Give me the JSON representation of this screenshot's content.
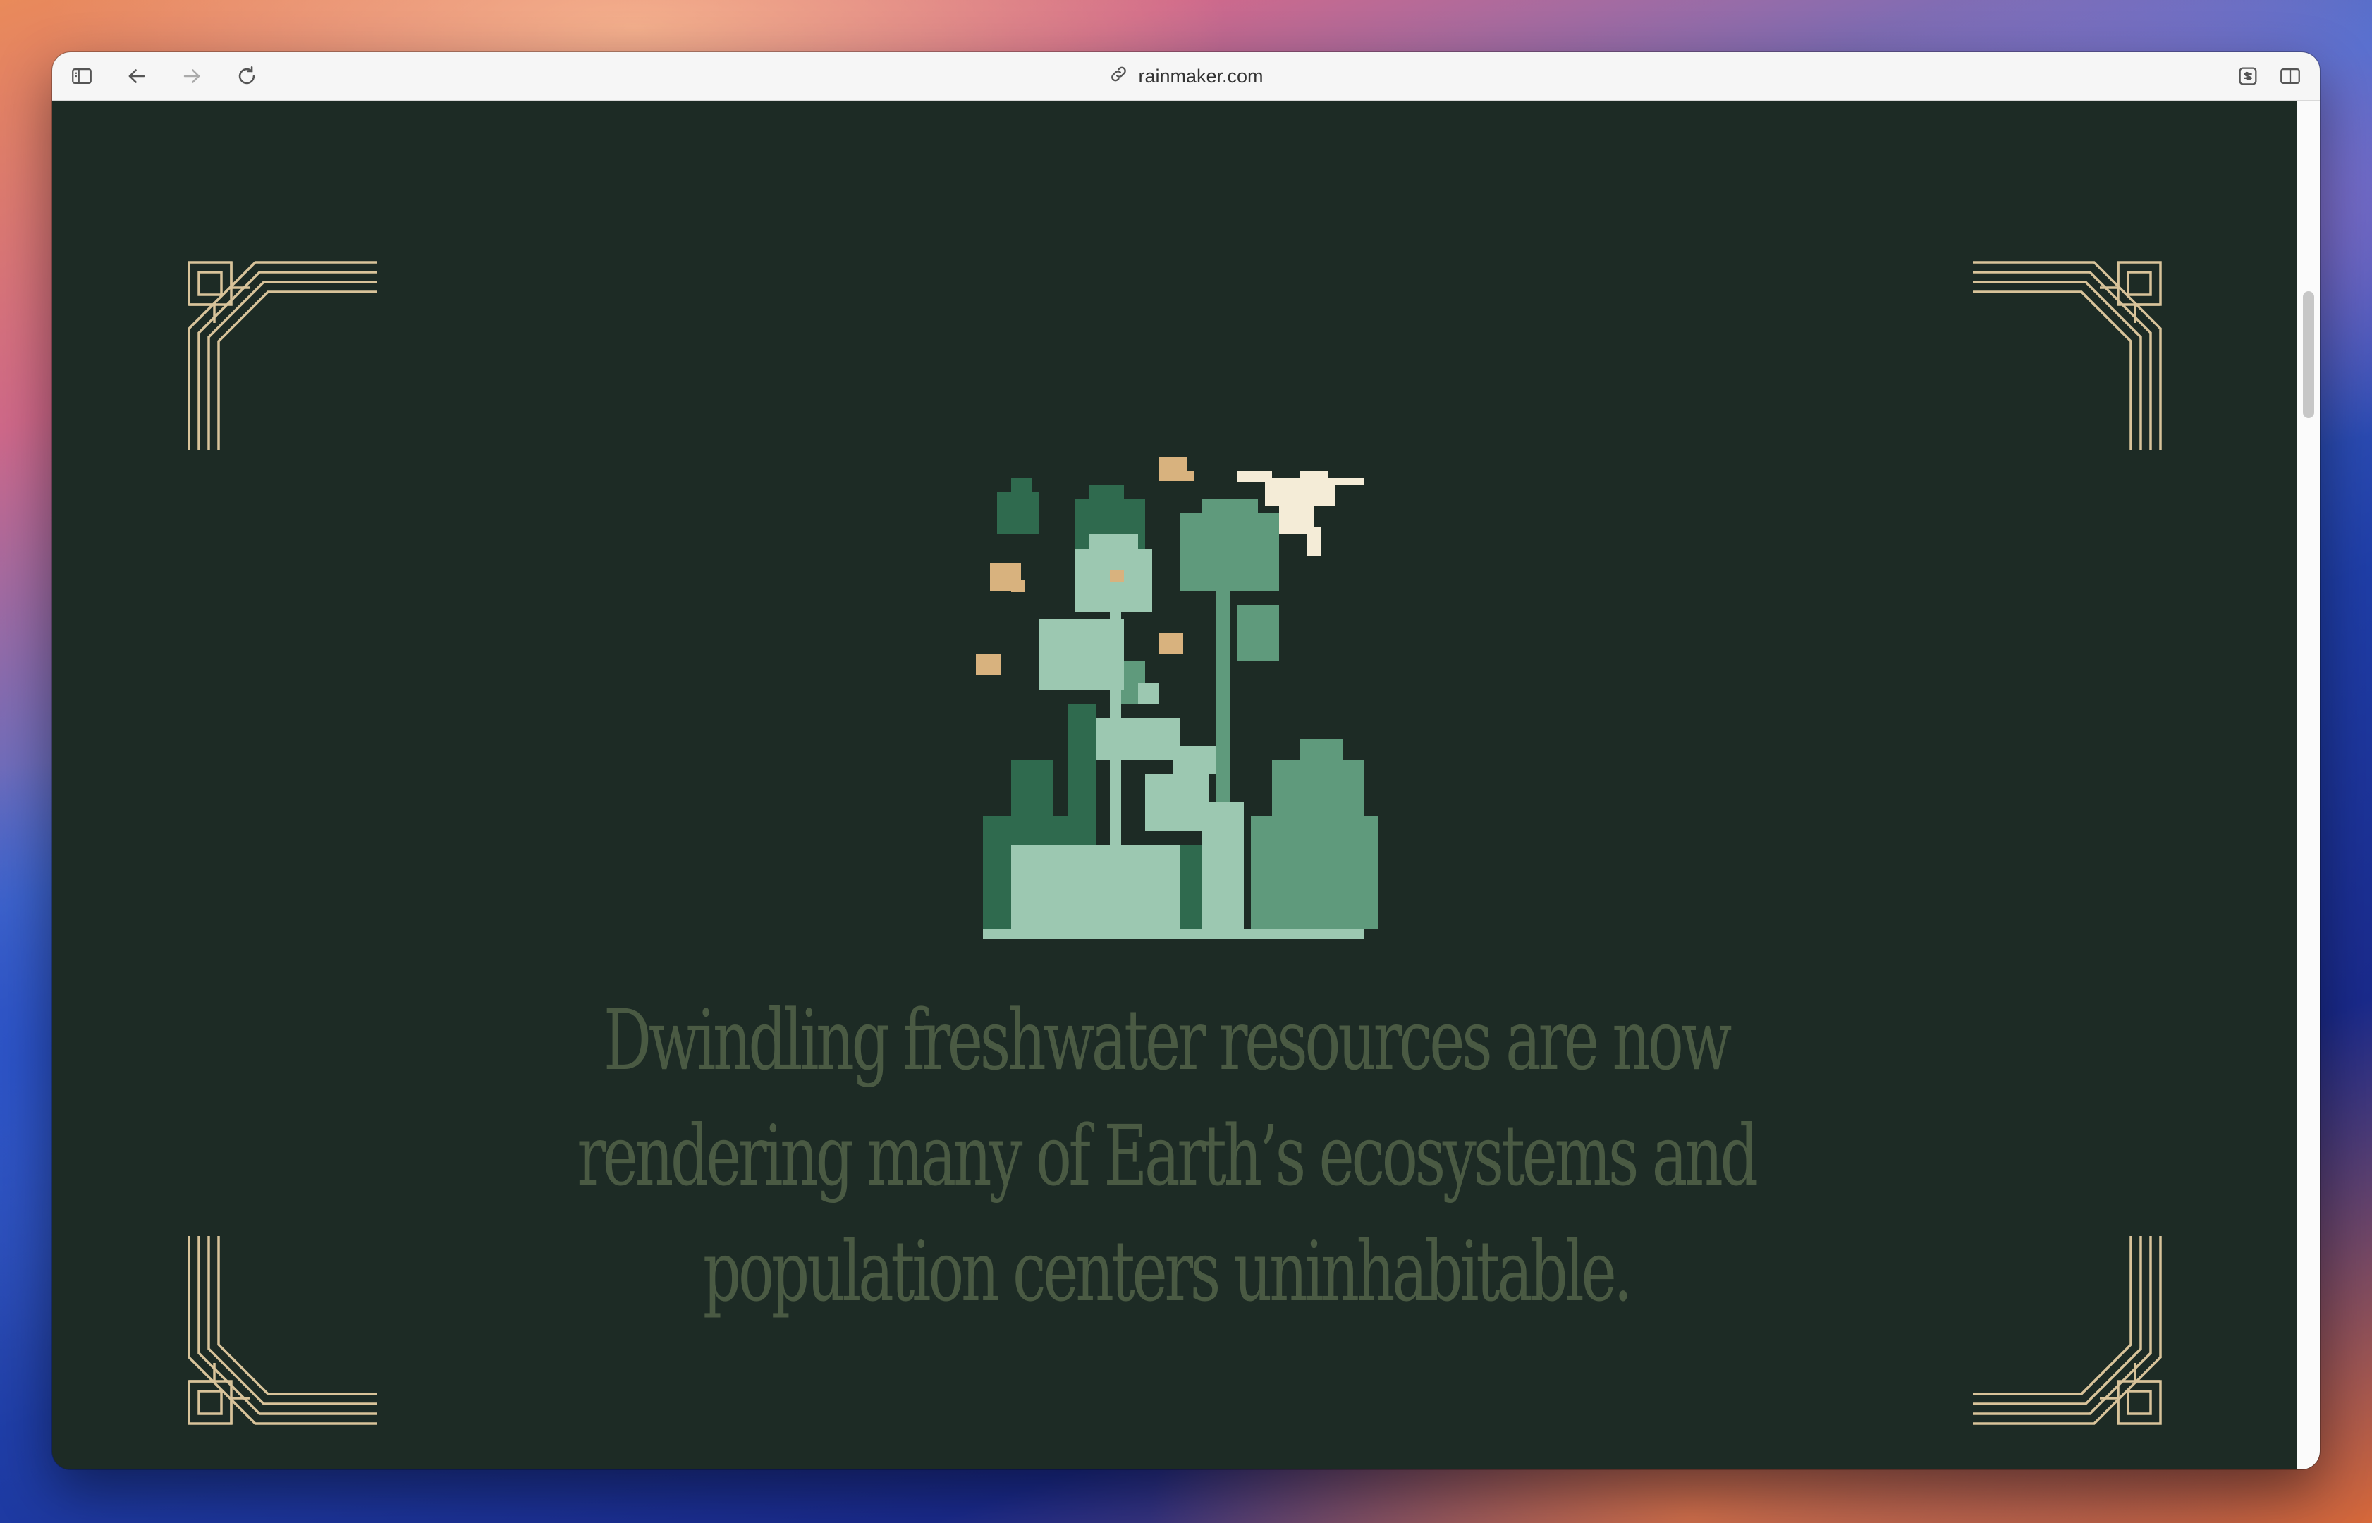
{
  "browser": {
    "url": "rainmaker.com",
    "icons": {
      "sidebar": "sidebar-icon",
      "back": "back-arrow-icon",
      "forward": "forward-arrow-icon",
      "reload": "reload-icon",
      "link": "link-icon",
      "extension": "extension-icon",
      "split_view": "split-view-icon"
    }
  },
  "page": {
    "background": "#1d2b25",
    "ornament_color": "#d8c39a",
    "headline": "Dwindling freshwater resources are now rendering many of Earth’s ecosystems and population centers uninhabitable.",
    "headline_color": "#4a5a43",
    "illustration": "pixel-art flowers with bees and hummingbird"
  }
}
